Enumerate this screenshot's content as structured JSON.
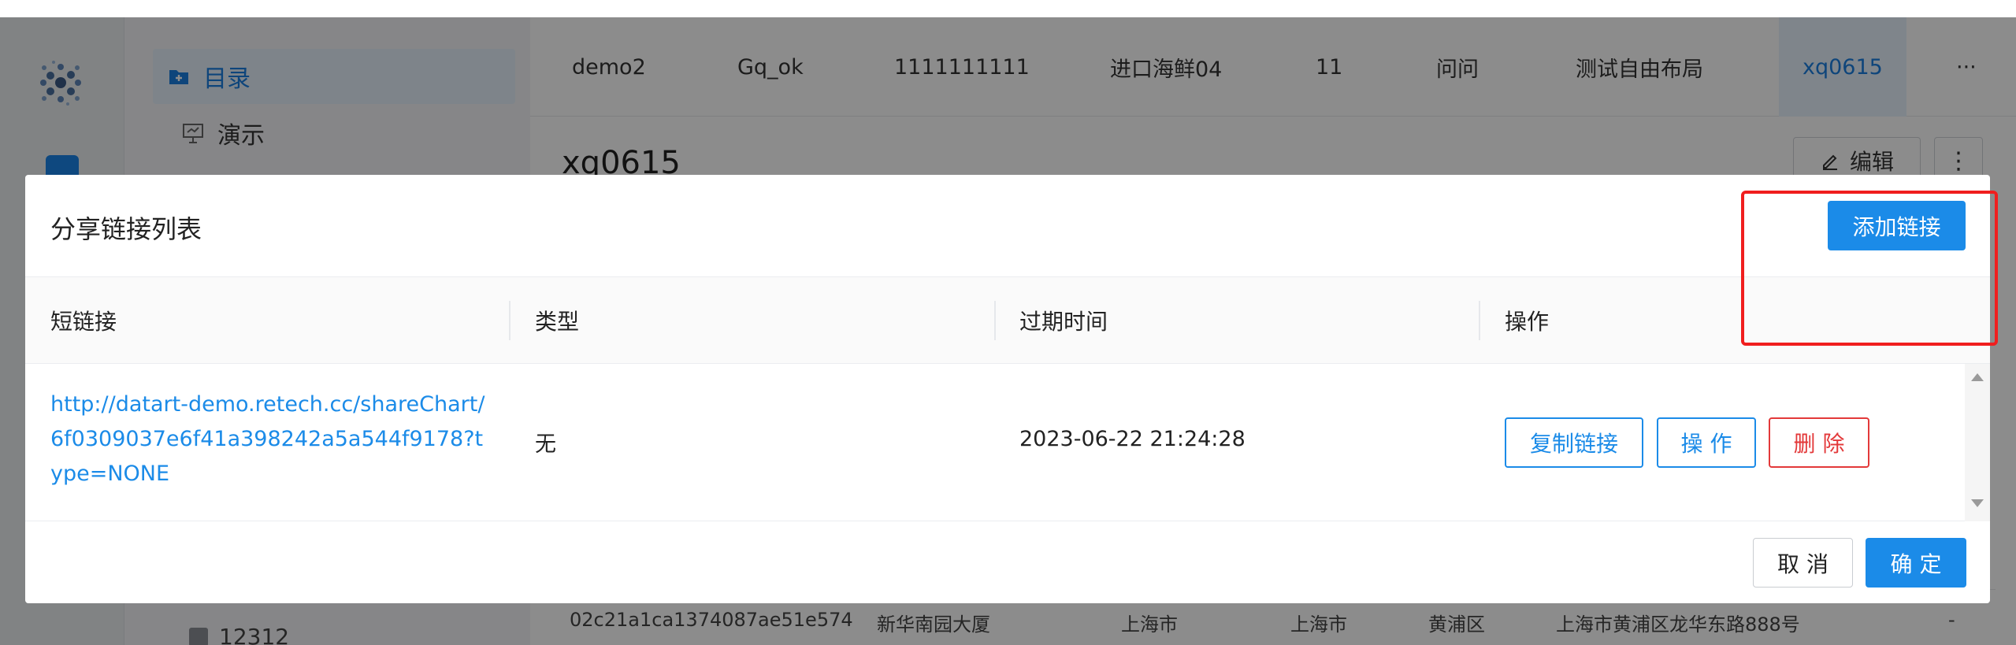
{
  "sidebar": {
    "items": [
      {
        "label": "目录",
        "icon": "folder-plus-icon"
      },
      {
        "label": "演示",
        "icon": "presentation-icon"
      }
    ],
    "bottom_item": "12312"
  },
  "tabs": [
    "demo2",
    "Gq_ok",
    "1111111111",
    "进口海鲜04",
    "11",
    "问问",
    "测试自由布局",
    "xq0615"
  ],
  "tabs_more": "···",
  "content": {
    "title": "xq0615",
    "edit_label": "编辑",
    "more_label": "⋮",
    "background_row": [
      "02c21a1ca1374087ae51e574",
      "新华南园大厦",
      "上海市",
      "上海市",
      "黄浦区",
      "上海市黄浦区龙华东路888号",
      "-"
    ]
  },
  "modal": {
    "title": "分享链接列表",
    "add_link_label": "添加链接",
    "columns": [
      "短链接",
      "类型",
      "过期时间",
      "操作"
    ],
    "rows": [
      {
        "link": "http://datart-demo.retech.cc/shareChart/6f0309037e6f41a398242a5a544f9178?type=NONE",
        "type": "无",
        "expiry": "2023-06-22 21:24:28",
        "actions": [
          "复制链接",
          "操 作",
          "删 除"
        ]
      }
    ],
    "cancel_label": "取 消",
    "ok_label": "确 定"
  },
  "colors": {
    "primary": "#1b8be8",
    "danger": "#e3393a",
    "highlight": "#f01e1e"
  }
}
